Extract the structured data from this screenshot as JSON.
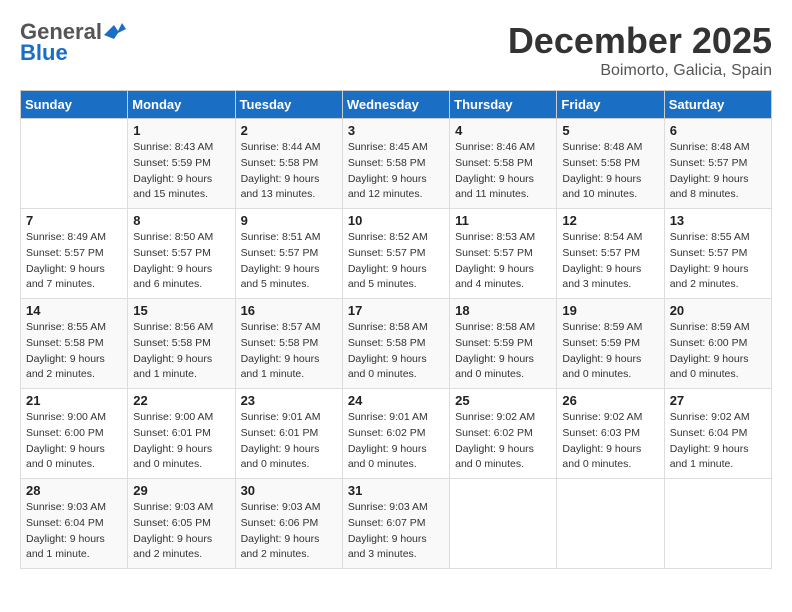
{
  "header": {
    "logo_general": "General",
    "logo_blue": "Blue",
    "month_title": "December 2025",
    "location": "Boimorto, Galicia, Spain"
  },
  "days_of_week": [
    "Sunday",
    "Monday",
    "Tuesday",
    "Wednesday",
    "Thursday",
    "Friday",
    "Saturday"
  ],
  "weeks": [
    [
      {
        "day": "",
        "info": ""
      },
      {
        "day": "1",
        "info": "Sunrise: 8:43 AM\nSunset: 5:59 PM\nDaylight: 9 hours\nand 15 minutes."
      },
      {
        "day": "2",
        "info": "Sunrise: 8:44 AM\nSunset: 5:58 PM\nDaylight: 9 hours\nand 13 minutes."
      },
      {
        "day": "3",
        "info": "Sunrise: 8:45 AM\nSunset: 5:58 PM\nDaylight: 9 hours\nand 12 minutes."
      },
      {
        "day": "4",
        "info": "Sunrise: 8:46 AM\nSunset: 5:58 PM\nDaylight: 9 hours\nand 11 minutes."
      },
      {
        "day": "5",
        "info": "Sunrise: 8:48 AM\nSunset: 5:58 PM\nDaylight: 9 hours\nand 10 minutes."
      },
      {
        "day": "6",
        "info": "Sunrise: 8:48 AM\nSunset: 5:57 PM\nDaylight: 9 hours\nand 8 minutes."
      }
    ],
    [
      {
        "day": "7",
        "info": "Sunrise: 8:49 AM\nSunset: 5:57 PM\nDaylight: 9 hours\nand 7 minutes."
      },
      {
        "day": "8",
        "info": "Sunrise: 8:50 AM\nSunset: 5:57 PM\nDaylight: 9 hours\nand 6 minutes."
      },
      {
        "day": "9",
        "info": "Sunrise: 8:51 AM\nSunset: 5:57 PM\nDaylight: 9 hours\nand 5 minutes."
      },
      {
        "day": "10",
        "info": "Sunrise: 8:52 AM\nSunset: 5:57 PM\nDaylight: 9 hours\nand 5 minutes."
      },
      {
        "day": "11",
        "info": "Sunrise: 8:53 AM\nSunset: 5:57 PM\nDaylight: 9 hours\nand 4 minutes."
      },
      {
        "day": "12",
        "info": "Sunrise: 8:54 AM\nSunset: 5:57 PM\nDaylight: 9 hours\nand 3 minutes."
      },
      {
        "day": "13",
        "info": "Sunrise: 8:55 AM\nSunset: 5:57 PM\nDaylight: 9 hours\nand 2 minutes."
      }
    ],
    [
      {
        "day": "14",
        "info": "Sunrise: 8:55 AM\nSunset: 5:58 PM\nDaylight: 9 hours\nand 2 minutes."
      },
      {
        "day": "15",
        "info": "Sunrise: 8:56 AM\nSunset: 5:58 PM\nDaylight: 9 hours\nand 1 minute."
      },
      {
        "day": "16",
        "info": "Sunrise: 8:57 AM\nSunset: 5:58 PM\nDaylight: 9 hours\nand 1 minute."
      },
      {
        "day": "17",
        "info": "Sunrise: 8:58 AM\nSunset: 5:58 PM\nDaylight: 9 hours\nand 0 minutes."
      },
      {
        "day": "18",
        "info": "Sunrise: 8:58 AM\nSunset: 5:59 PM\nDaylight: 9 hours\nand 0 minutes."
      },
      {
        "day": "19",
        "info": "Sunrise: 8:59 AM\nSunset: 5:59 PM\nDaylight: 9 hours\nand 0 minutes."
      },
      {
        "day": "20",
        "info": "Sunrise: 8:59 AM\nSunset: 6:00 PM\nDaylight: 9 hours\nand 0 minutes."
      }
    ],
    [
      {
        "day": "21",
        "info": "Sunrise: 9:00 AM\nSunset: 6:00 PM\nDaylight: 9 hours\nand 0 minutes."
      },
      {
        "day": "22",
        "info": "Sunrise: 9:00 AM\nSunset: 6:01 PM\nDaylight: 9 hours\nand 0 minutes."
      },
      {
        "day": "23",
        "info": "Sunrise: 9:01 AM\nSunset: 6:01 PM\nDaylight: 9 hours\nand 0 minutes."
      },
      {
        "day": "24",
        "info": "Sunrise: 9:01 AM\nSunset: 6:02 PM\nDaylight: 9 hours\nand 0 minutes."
      },
      {
        "day": "25",
        "info": "Sunrise: 9:02 AM\nSunset: 6:02 PM\nDaylight: 9 hours\nand 0 minutes."
      },
      {
        "day": "26",
        "info": "Sunrise: 9:02 AM\nSunset: 6:03 PM\nDaylight: 9 hours\nand 0 minutes."
      },
      {
        "day": "27",
        "info": "Sunrise: 9:02 AM\nSunset: 6:04 PM\nDaylight: 9 hours\nand 1 minute."
      }
    ],
    [
      {
        "day": "28",
        "info": "Sunrise: 9:03 AM\nSunset: 6:04 PM\nDaylight: 9 hours\nand 1 minute."
      },
      {
        "day": "29",
        "info": "Sunrise: 9:03 AM\nSunset: 6:05 PM\nDaylight: 9 hours\nand 2 minutes."
      },
      {
        "day": "30",
        "info": "Sunrise: 9:03 AM\nSunset: 6:06 PM\nDaylight: 9 hours\nand 2 minutes."
      },
      {
        "day": "31",
        "info": "Sunrise: 9:03 AM\nSunset: 6:07 PM\nDaylight: 9 hours\nand 3 minutes."
      },
      {
        "day": "",
        "info": ""
      },
      {
        "day": "",
        "info": ""
      },
      {
        "day": "",
        "info": ""
      }
    ]
  ]
}
